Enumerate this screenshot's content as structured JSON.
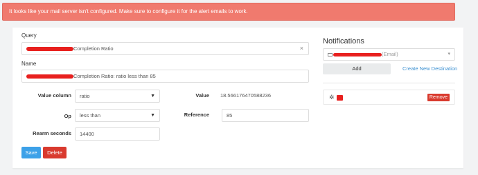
{
  "alert": {
    "text": "It looks like your mail server isn't configured. Make sure to configure it for the alert emails to work."
  },
  "form": {
    "query_label": "Query",
    "query_value": "Completion Ratio",
    "name_label": "Name",
    "name_value": "Completion Ratio: ratio less than 85",
    "value_column_label": "Value column",
    "value_column_value": "ratio",
    "value_label": "Value",
    "value_value": "18.566176470588236",
    "op_label": "Op",
    "op_value": "less than",
    "reference_label": "Reference",
    "reference_value": "85",
    "rearm_label": "Rearm seconds",
    "rearm_value": "14400",
    "save_label": "Save",
    "delete_label": "Delete"
  },
  "notifications": {
    "title": "Notifications",
    "destination_value": "(Email)",
    "add_label": "Add",
    "create_link": "Create New Destination",
    "remove_label": "Remove"
  },
  "colors": {
    "alert_bg": "#f07a6e",
    "save": "#3da1e8",
    "delete": "#d93a2e",
    "link": "#3a8fd1",
    "redaction": "#e8201e"
  },
  "icons": {
    "clear": "close-icon",
    "dropdown": "caret-down-icon",
    "destination_type": "email-icon",
    "slack": "slack-icon"
  }
}
